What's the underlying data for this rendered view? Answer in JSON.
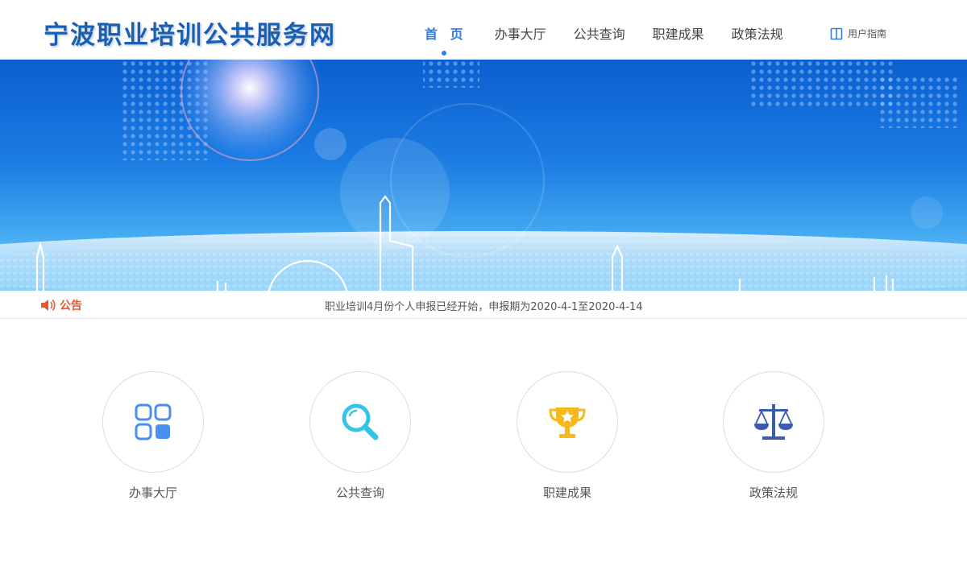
{
  "header": {
    "logo": "宁波职业培训公共服务网",
    "nav": [
      {
        "label": "首 页",
        "active": true
      },
      {
        "label": "办事大厅",
        "active": false
      },
      {
        "label": "公共查询",
        "active": false
      },
      {
        "label": "职建成果",
        "active": false
      },
      {
        "label": "政策法规",
        "active": false
      }
    ],
    "guide_label": "用户指南",
    "guide_icon": "book-icon"
  },
  "notice": {
    "label": "公告",
    "icon": "speaker-icon",
    "text": "职业培训4月份个人申报已经开始，申报期为2020-4-1至2020-4-14"
  },
  "services": [
    {
      "label": "办事大厅",
      "icon": "grid-icon"
    },
    {
      "label": "公共查询",
      "icon": "search-icon"
    },
    {
      "label": "职建成果",
      "icon": "trophy-icon"
    },
    {
      "label": "政策法规",
      "icon": "scales-icon"
    }
  ],
  "colors": {
    "accent": "#2e7be3",
    "logo": "#1a5fb4",
    "notice": "#e8572e",
    "grid_icon": "#4a8ef2",
    "search_icon": "#35c4e8",
    "trophy_icon": "#f7b81b",
    "scales_icon": "#3a5bb0"
  }
}
